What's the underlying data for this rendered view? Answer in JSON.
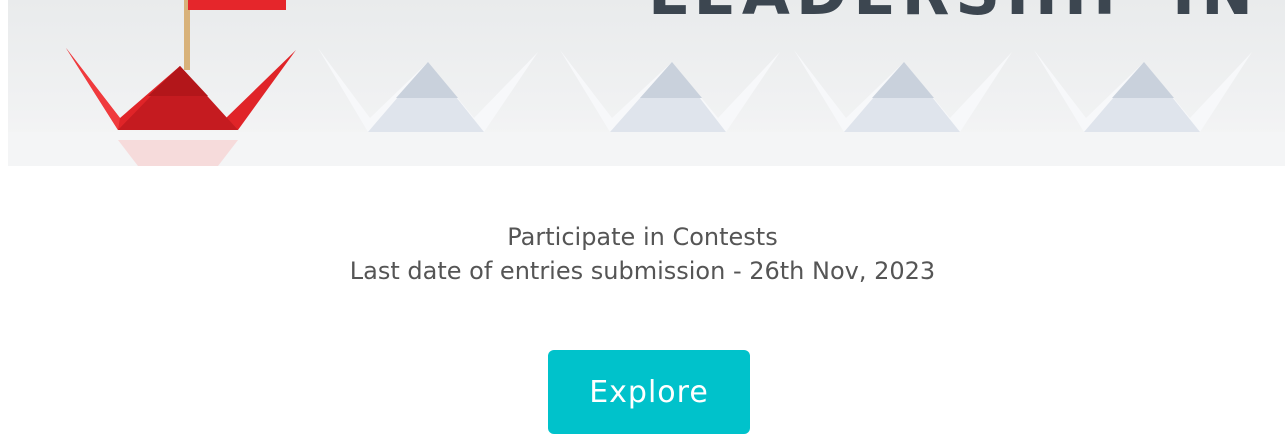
{
  "banner": {
    "headline": "LEADERSHIP IN QUALITY"
  },
  "contest": {
    "title": "Participate in Contests",
    "deadline": "Last date of entries submission - 26th Nov, 2023"
  },
  "cta": {
    "label": "Explore",
    "color": "#00c2cb"
  },
  "colors": {
    "text": "#555555",
    "accent_boat": "#e5262b",
    "headline": "#3c4650"
  }
}
